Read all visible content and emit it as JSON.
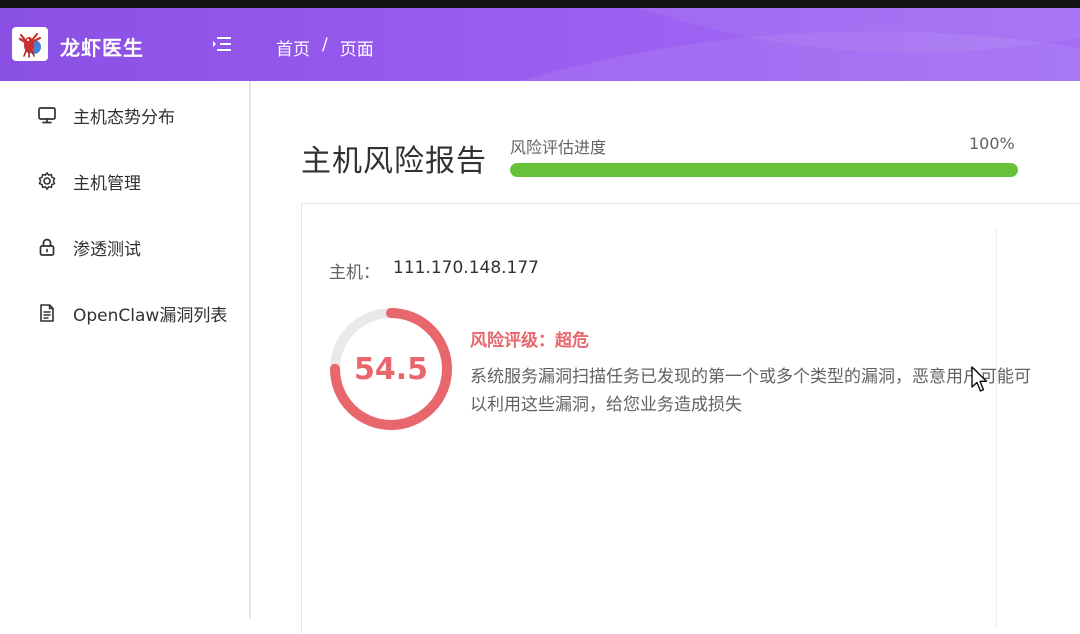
{
  "header": {
    "app_title": "龙虾医生",
    "logo_icon": "lobster-logo-icon",
    "menu_icon": "menu-fold-icon",
    "breadcrumb": [
      "首页",
      "页面"
    ],
    "breadcrumb_separator": "/",
    "gradient_colors": [
      "#8a4fe3",
      "#a36ef4"
    ]
  },
  "sidebar": {
    "items": [
      {
        "label": "主机态势分布",
        "icon": "monitor-icon"
      },
      {
        "label": "主机管理",
        "icon": "gear-icon"
      },
      {
        "label": "渗透测试",
        "icon": "lock-icon"
      },
      {
        "label": "OpenClaw漏洞列表",
        "icon": "document-icon"
      }
    ]
  },
  "main": {
    "title": "主机风险报告",
    "progress": {
      "label": "风险评估进度",
      "percent_text": "100%",
      "value": 100,
      "color": "#67c23a"
    },
    "report": {
      "host_label": "主机：",
      "host_value": "111.170.148.177",
      "score": "54.5",
      "gauge_fraction": 0.75,
      "gauge_color": "#e8676d",
      "risk_level": "风险评级：超危",
      "description": "系统服务漏洞扫描任务已发现的第一个或多个类型的漏洞，恶意用户可能可以利用这些漏洞，给您业务造成损失"
    }
  }
}
